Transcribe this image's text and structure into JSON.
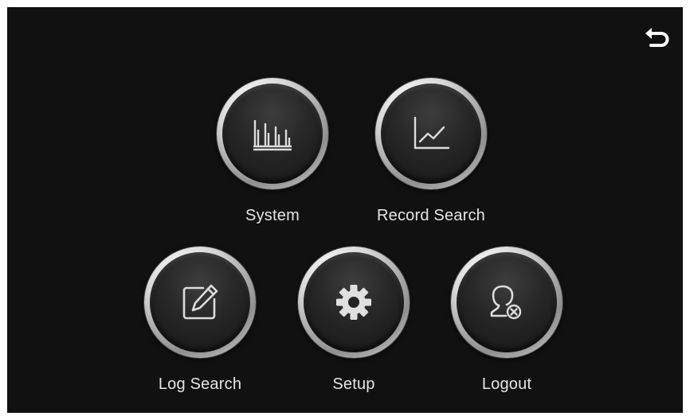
{
  "colors": {
    "background": "#111111",
    "label_text": "#e6e6e6",
    "icon_stroke": "#dcdcdc",
    "ring_silver": "#d6d6d6"
  },
  "header": {
    "back_icon": "back-arrow-icon"
  },
  "menu": {
    "items": [
      {
        "label": "System",
        "icon": "bar-chart-icon"
      },
      {
        "label": "Record Search",
        "icon": "line-chart-icon"
      },
      {
        "label": "Log Search",
        "icon": "edit-icon"
      },
      {
        "label": "Setup",
        "icon": "gear-icon"
      },
      {
        "label": "Logout",
        "icon": "user-remove-icon"
      }
    ]
  }
}
